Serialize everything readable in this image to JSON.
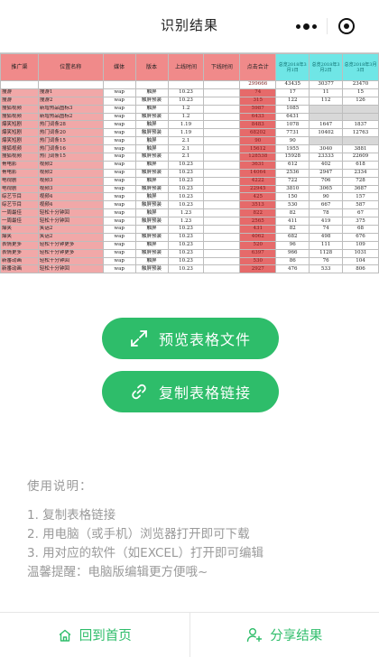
{
  "nav": {
    "title": "识别结果"
  },
  "sheet": {
    "headers": [
      "推广渠",
      "位置名称",
      "媒体",
      "版本",
      "上线时间",
      "下线时间",
      "点击合计",
      "总览2018年3月1日",
      "总览2018年3月2日",
      "总览2018年3月3日"
    ],
    "summary": [
      "",
      "",
      "",
      "",
      "",
      "",
      "299666",
      "43435",
      "30377",
      "23470"
    ],
    "rows": [
      [
        "搜游",
        "搜游1",
        "wap",
        "触屏",
        "10.23",
        "",
        "74",
        "17",
        "11",
        "15"
      ],
      [
        "搜游",
        "搜游2",
        "wap",
        "触屏预装",
        "10.23",
        "",
        "315",
        "122",
        "112",
        "126"
      ],
      [
        "搜狐视频",
        "新增热品图标3",
        "wap",
        "触屏",
        "1.2",
        "",
        "5987",
        "1085",
        "",
        ""
      ],
      [
        "搜狐视频",
        "新增热品图标2",
        "wap",
        "触屏预装",
        "1.2",
        "",
        "6433",
        "6431",
        "",
        ""
      ],
      [
        "爆笑短剧",
        "热门词条28",
        "wap",
        "触屏",
        "1.19",
        "",
        "8483",
        "1078",
        "1647",
        "1837"
      ],
      [
        "爆笑短剧",
        "热门词条20",
        "wap",
        "触屏预装",
        "1.19",
        "",
        "68202",
        "7731",
        "10402",
        "12763"
      ],
      [
        "爆笑短剧",
        "热门词条15",
        "wap",
        "触屏",
        "2.1",
        "",
        "90",
        "90",
        "",
        ""
      ],
      [
        "搜狐视频",
        "热门词条16",
        "wap",
        "触屏",
        "2.1",
        "",
        "15612",
        "1955",
        "3040",
        "3881"
      ],
      [
        "搜狐视频",
        "热门词条15",
        "wap",
        "触屏预装",
        "2.1",
        "",
        "128538",
        "15928",
        "23333",
        "22609"
      ],
      [
        "骨电影",
        "视频2",
        "wap",
        "触屏",
        "10.23",
        "",
        "3631",
        "612",
        "402",
        "618"
      ],
      [
        "骨电影",
        "视频2",
        "wap",
        "触屏预装",
        "10.23",
        "",
        "14064",
        "2536",
        "2947",
        "2334"
      ],
      [
        "电视剧",
        "视频3",
        "wap",
        "触屏",
        "10.23",
        "",
        "4222",
        "722",
        "706",
        "728"
      ],
      [
        "电视剧",
        "视频3",
        "wap",
        "触屏预装",
        "10.23",
        "",
        "22945",
        "3810",
        "3065",
        "3687"
      ],
      [
        "综艺节目",
        "视频4",
        "wap",
        "触屏",
        "10.23",
        "",
        "425",
        "150",
        "90",
        "157"
      ],
      [
        "综艺节目",
        "视频4",
        "wap",
        "触屏预装",
        "10.23",
        "",
        "3513",
        "530",
        "667",
        "587"
      ],
      [
        "一周最佳",
        "轻松十分钟回",
        "wap",
        "触屏",
        "1.23",
        "",
        "822",
        "82",
        "78",
        "67"
      ],
      [
        "一周最佳",
        "轻松十分钟回",
        "wap",
        "触屏预装",
        "1.23",
        "",
        "2565",
        "411",
        "419",
        "375"
      ],
      [
        "爆笑",
        "笑话2",
        "wap",
        "触屏",
        "10.23",
        "",
        "431",
        "82",
        "74",
        "68"
      ],
      [
        "爆笑",
        "笑话2",
        "wap",
        "触屏预装",
        "10.23",
        "",
        "4062",
        "682",
        "498",
        "676"
      ],
      [
        "表情更多",
        "轻松十分钟更多",
        "wap",
        "触屏",
        "10.23",
        "",
        "520",
        "96",
        "111",
        "109"
      ],
      [
        "表情更多",
        "轻松十分钟更多",
        "wap",
        "触屏预装",
        "10.23",
        "",
        "6397",
        "966",
        "1128",
        "1031"
      ],
      [
        "新番动画",
        "轻松十分钟回",
        "wap",
        "触屏",
        "10.23",
        "",
        "530",
        "86",
        "76",
        "104"
      ],
      [
        "新番动画",
        "轻松十分钟回",
        "wap",
        "触屏预装",
        "10.23",
        "",
        "2927",
        "476",
        "533",
        "806"
      ]
    ]
  },
  "buttons": {
    "preview": {
      "label": "预览表格文件",
      "icon": "expand-icon"
    },
    "copy": {
      "label": "复制表格链接",
      "icon": "link-icon"
    }
  },
  "instructions": {
    "heading": "使用说明：",
    "lines": [
      "1. 复制表格链接",
      "2. 用电脑（或手机）浏览器打开即可下载",
      "3. 用对应的软件（如EXCEL）打开即可编辑",
      "温馨提醒：电脑版编辑更方便哦~"
    ]
  },
  "tabs": {
    "home": {
      "label": "回到首页",
      "icon": "home-icon"
    },
    "share": {
      "label": "分享结果",
      "icon": "add-user-icon"
    }
  },
  "colors": {
    "accent": "#2ebd6a",
    "header_red": "#f08a8a",
    "header_cyan": "#6fe6e6"
  }
}
